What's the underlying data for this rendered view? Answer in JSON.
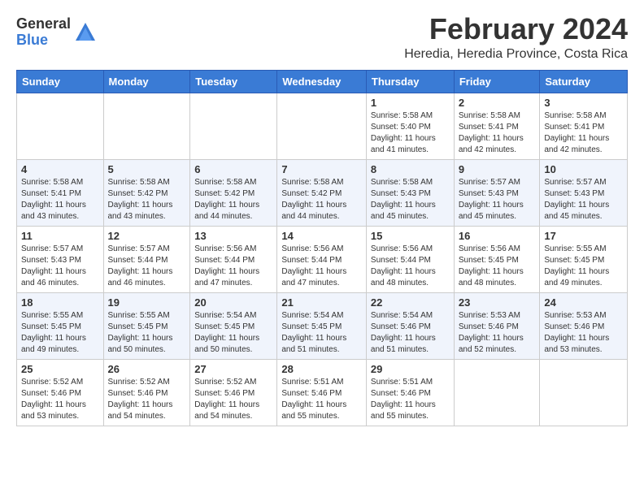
{
  "header": {
    "logo_general": "General",
    "logo_blue": "Blue",
    "month_year": "February 2024",
    "location": "Heredia, Heredia Province, Costa Rica"
  },
  "weekdays": [
    "Sunday",
    "Monday",
    "Tuesday",
    "Wednesday",
    "Thursday",
    "Friday",
    "Saturday"
  ],
  "weeks": [
    [
      {
        "day": "",
        "info": ""
      },
      {
        "day": "",
        "info": ""
      },
      {
        "day": "",
        "info": ""
      },
      {
        "day": "",
        "info": ""
      },
      {
        "day": "1",
        "info": "Sunrise: 5:58 AM\nSunset: 5:40 PM\nDaylight: 11 hours\nand 41 minutes."
      },
      {
        "day": "2",
        "info": "Sunrise: 5:58 AM\nSunset: 5:41 PM\nDaylight: 11 hours\nand 42 minutes."
      },
      {
        "day": "3",
        "info": "Sunrise: 5:58 AM\nSunset: 5:41 PM\nDaylight: 11 hours\nand 42 minutes."
      }
    ],
    [
      {
        "day": "4",
        "info": "Sunrise: 5:58 AM\nSunset: 5:41 PM\nDaylight: 11 hours\nand 43 minutes."
      },
      {
        "day": "5",
        "info": "Sunrise: 5:58 AM\nSunset: 5:42 PM\nDaylight: 11 hours\nand 43 minutes."
      },
      {
        "day": "6",
        "info": "Sunrise: 5:58 AM\nSunset: 5:42 PM\nDaylight: 11 hours\nand 44 minutes."
      },
      {
        "day": "7",
        "info": "Sunrise: 5:58 AM\nSunset: 5:42 PM\nDaylight: 11 hours\nand 44 minutes."
      },
      {
        "day": "8",
        "info": "Sunrise: 5:58 AM\nSunset: 5:43 PM\nDaylight: 11 hours\nand 45 minutes."
      },
      {
        "day": "9",
        "info": "Sunrise: 5:57 AM\nSunset: 5:43 PM\nDaylight: 11 hours\nand 45 minutes."
      },
      {
        "day": "10",
        "info": "Sunrise: 5:57 AM\nSunset: 5:43 PM\nDaylight: 11 hours\nand 45 minutes."
      }
    ],
    [
      {
        "day": "11",
        "info": "Sunrise: 5:57 AM\nSunset: 5:43 PM\nDaylight: 11 hours\nand 46 minutes."
      },
      {
        "day": "12",
        "info": "Sunrise: 5:57 AM\nSunset: 5:44 PM\nDaylight: 11 hours\nand 46 minutes."
      },
      {
        "day": "13",
        "info": "Sunrise: 5:56 AM\nSunset: 5:44 PM\nDaylight: 11 hours\nand 47 minutes."
      },
      {
        "day": "14",
        "info": "Sunrise: 5:56 AM\nSunset: 5:44 PM\nDaylight: 11 hours\nand 47 minutes."
      },
      {
        "day": "15",
        "info": "Sunrise: 5:56 AM\nSunset: 5:44 PM\nDaylight: 11 hours\nand 48 minutes."
      },
      {
        "day": "16",
        "info": "Sunrise: 5:56 AM\nSunset: 5:45 PM\nDaylight: 11 hours\nand 48 minutes."
      },
      {
        "day": "17",
        "info": "Sunrise: 5:55 AM\nSunset: 5:45 PM\nDaylight: 11 hours\nand 49 minutes."
      }
    ],
    [
      {
        "day": "18",
        "info": "Sunrise: 5:55 AM\nSunset: 5:45 PM\nDaylight: 11 hours\nand 49 minutes."
      },
      {
        "day": "19",
        "info": "Sunrise: 5:55 AM\nSunset: 5:45 PM\nDaylight: 11 hours\nand 50 minutes."
      },
      {
        "day": "20",
        "info": "Sunrise: 5:54 AM\nSunset: 5:45 PM\nDaylight: 11 hours\nand 50 minutes."
      },
      {
        "day": "21",
        "info": "Sunrise: 5:54 AM\nSunset: 5:45 PM\nDaylight: 11 hours\nand 51 minutes."
      },
      {
        "day": "22",
        "info": "Sunrise: 5:54 AM\nSunset: 5:46 PM\nDaylight: 11 hours\nand 51 minutes."
      },
      {
        "day": "23",
        "info": "Sunrise: 5:53 AM\nSunset: 5:46 PM\nDaylight: 11 hours\nand 52 minutes."
      },
      {
        "day": "24",
        "info": "Sunrise: 5:53 AM\nSunset: 5:46 PM\nDaylight: 11 hours\nand 53 minutes."
      }
    ],
    [
      {
        "day": "25",
        "info": "Sunrise: 5:52 AM\nSunset: 5:46 PM\nDaylight: 11 hours\nand 53 minutes."
      },
      {
        "day": "26",
        "info": "Sunrise: 5:52 AM\nSunset: 5:46 PM\nDaylight: 11 hours\nand 54 minutes."
      },
      {
        "day": "27",
        "info": "Sunrise: 5:52 AM\nSunset: 5:46 PM\nDaylight: 11 hours\nand 54 minutes."
      },
      {
        "day": "28",
        "info": "Sunrise: 5:51 AM\nSunset: 5:46 PM\nDaylight: 11 hours\nand 55 minutes."
      },
      {
        "day": "29",
        "info": "Sunrise: 5:51 AM\nSunset: 5:46 PM\nDaylight: 11 hours\nand 55 minutes."
      },
      {
        "day": "",
        "info": ""
      },
      {
        "day": "",
        "info": ""
      }
    ]
  ]
}
